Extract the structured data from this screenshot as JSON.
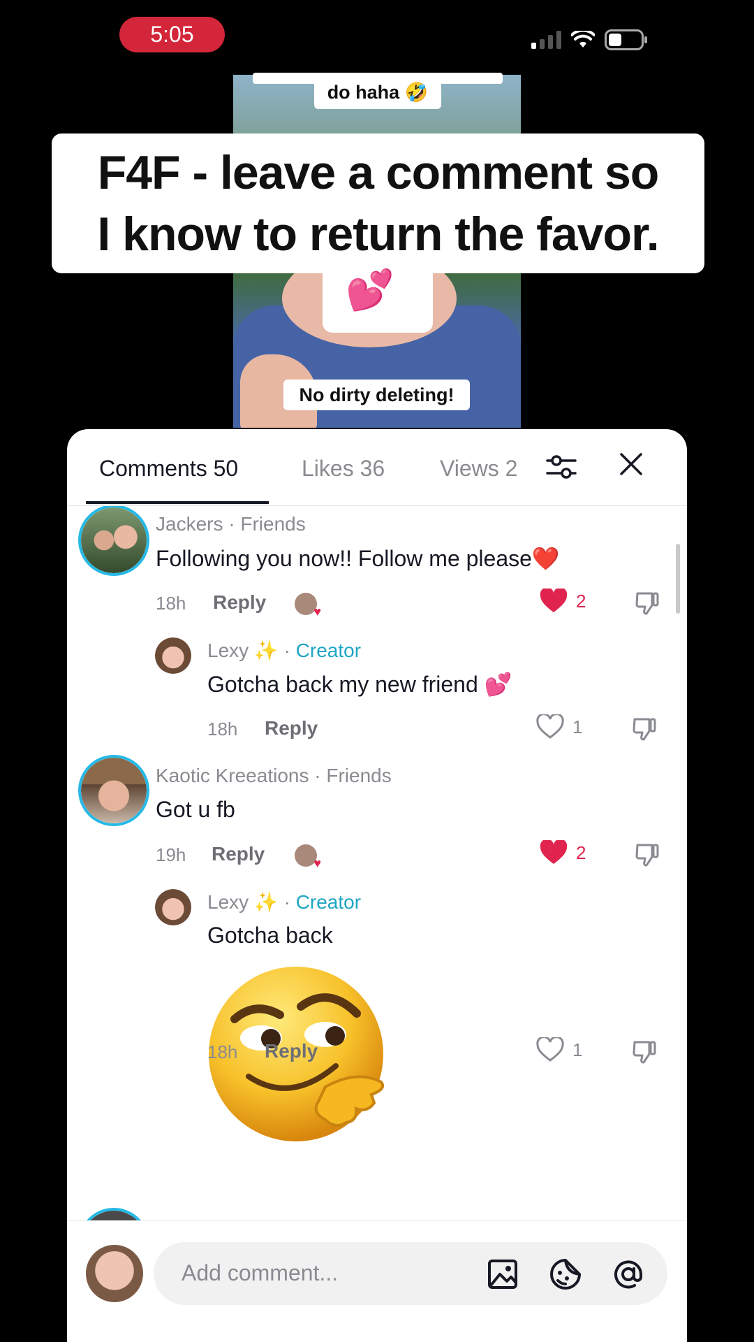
{
  "status_bar": {
    "time": "5:05"
  },
  "video": {
    "top_caption": "do haha 🤣",
    "headline": "F4F - leave a comment so\nI know to return the favor.",
    "hearts_emoji": "💕",
    "bottom_caption": "No dirty deleting!"
  },
  "tabs": [
    {
      "label": "Comments 50"
    },
    {
      "label": "Likes 36"
    },
    {
      "label": "Views 2"
    }
  ],
  "icons": {
    "filter": "sliders-icon",
    "close": "close-icon"
  },
  "comments": [
    {
      "author": "Jackers",
      "tag": "Friends",
      "text": "Following you now!! Follow me please❤️",
      "time": "18h",
      "reply": "Reply",
      "likes": "2",
      "liked": true
    },
    {
      "author": "Lexy ✨",
      "tag": "Creator",
      "text": "Gotcha back my new friend 💕",
      "time": "18h",
      "reply": "Reply",
      "likes": "1",
      "liked": false
    },
    {
      "author": "Kaotic Kreeations",
      "tag": "Friends",
      "text": "Got u fb",
      "time": "19h",
      "reply": "Reply",
      "likes": "2",
      "liked": true
    },
    {
      "author": "Lexy ✨",
      "tag": "Creator",
      "text": "Gotcha back",
      "time": "18h",
      "reply": "Reply",
      "likes": "1",
      "liked": false
    }
  ],
  "composer": {
    "placeholder": "Add comment..."
  },
  "colors": {
    "like_red": "#e0244f",
    "creator_teal": "#1fa5c3",
    "ring_blue": "#25b9e6"
  }
}
